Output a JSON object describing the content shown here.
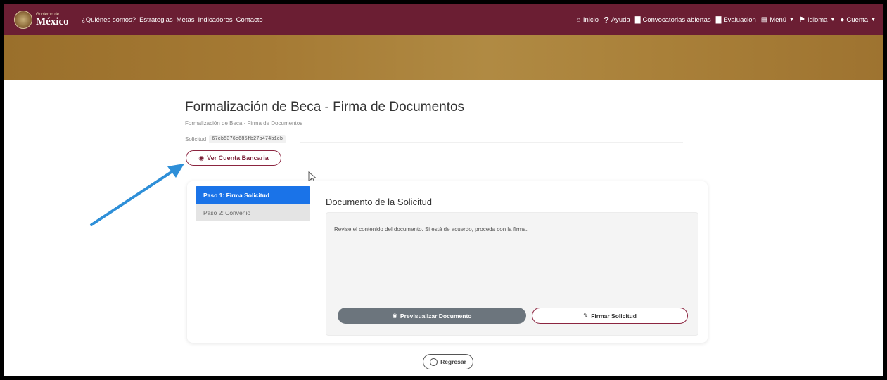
{
  "nav": {
    "logo_small": "Gobierno de",
    "logo_big": "México",
    "links": [
      "¿Quiénes somos?",
      "Estrategias",
      "Metas",
      "Indicadores",
      "Contacto"
    ],
    "right": {
      "inicio": "Inicio",
      "ayuda": "Ayuda",
      "convocatorias": "Convocatorias abiertas",
      "evaluacion": "Evaluacion",
      "menu": "Menú",
      "idioma": "Idioma",
      "cuenta": "Cuenta"
    },
    "icons": {
      "inicio": "home-icon",
      "ayuda": "question-icon",
      "convocatorias": "book-icon",
      "evaluacion": "book-icon",
      "menu": "menu-icon",
      "idioma": "flag-icon",
      "cuenta": "user-icon"
    }
  },
  "page": {
    "title": "Formalización de Beca - Firma de Documentos",
    "breadcrumb": "Formalización de Beca - Firma de Documentos",
    "solicitud_label": "Solicitud",
    "solicitud_id": "67cb5376e685fb27b474b1cb",
    "ver_cuenta_label": "Ver Cuenta Bancaria"
  },
  "steps": [
    {
      "label": "Paso 1: Firma Solicitud",
      "active": true
    },
    {
      "label": "Paso 2: Convenio",
      "active": false
    }
  ],
  "document": {
    "title": "Documento de la Solicitud",
    "instructions": "Revise el contenido del documento. Si está de acuerdo, proceda con la firma.",
    "preview_label": "Previsualizar Documento",
    "sign_label": "Firmar Solicitud"
  },
  "footer": {
    "back_label": "Regresar"
  },
  "colors": {
    "nav_bg": "#6b1e33",
    "banner": "#a57a34",
    "accent": "#8c2540",
    "step_active": "#1a73e8",
    "preview_btn": "#6c757d",
    "annotation_arrow": "#2e8fd8"
  }
}
